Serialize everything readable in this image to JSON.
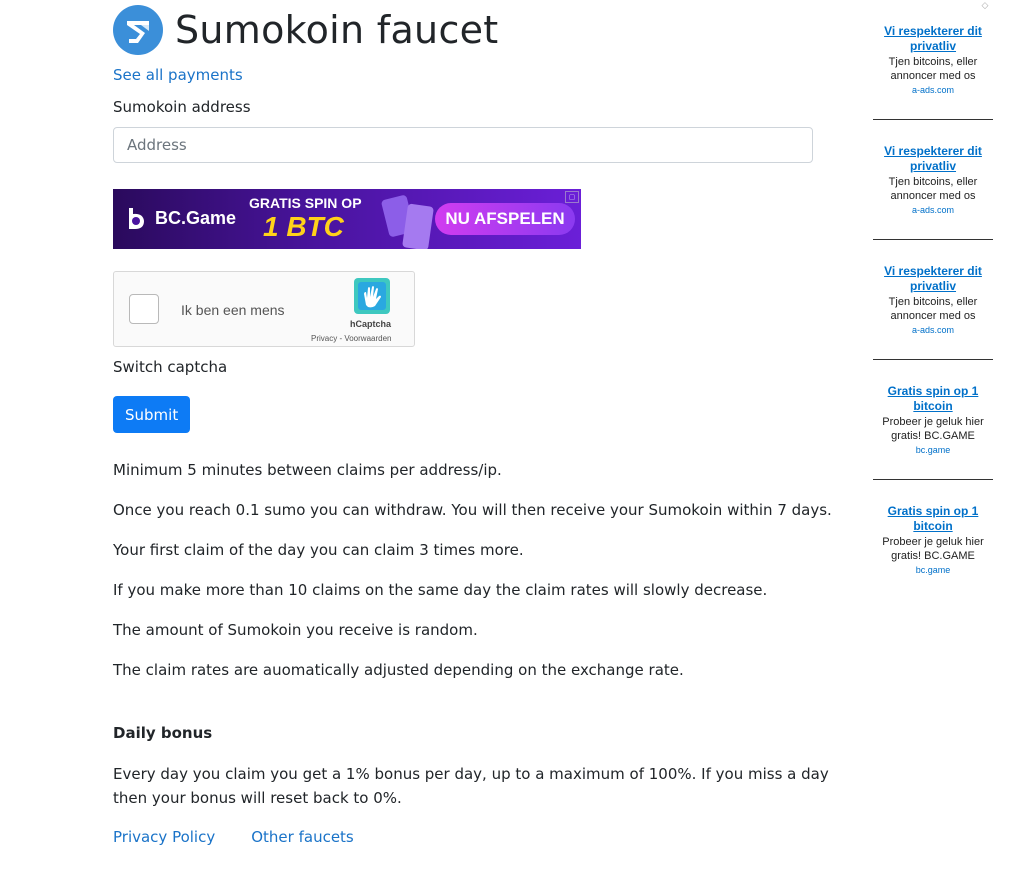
{
  "header": {
    "title": "Sumokoin faucet",
    "logo_icon": "sumokoin-logo-icon",
    "brand_color": "#3b8fd9"
  },
  "nav": {
    "see_all_payments": "See all payments"
  },
  "form": {
    "address_label": "Sumokoin address",
    "address_placeholder": "Address",
    "address_value": "",
    "switch_captcha": "Switch captcha",
    "submit_label": "Submit",
    "submit_color": "#0d7bf5"
  },
  "banner": {
    "brand": "BC.Game",
    "promo_line": "GRATIS SPIN OP",
    "promo_big": "1 BTC",
    "cta": "NU AFSPELEN"
  },
  "captcha": {
    "checkbox_label": "Ik ben een mens",
    "brand": "hCaptcha",
    "terms": "Privacy - Voorwaarden"
  },
  "info": [
    "Minimum 5 minutes between claims per address/ip.",
    "Once you reach 0.1 sumo you can withdraw. You will then receive your Sumokoin within 7 days.",
    "Your first claim of the day you can claim 3 times more.",
    "If you make more than 10 claims on the same day the claim rates will slowly decrease.",
    "The amount of Sumokoin you receive is random.",
    "The claim rates are auomatically adjusted depending on the exchange rate."
  ],
  "bonus": {
    "heading": "Daily bonus",
    "text": "Every day you claim you get a 1% bonus per day, up to a maximum of 100%. If you miss a day then your bonus will reset back to 0%."
  },
  "footer": {
    "privacy": "Privacy Policy",
    "other": "Other faucets"
  },
  "sidebar_ads": [
    {
      "title": "Vi respekterer dit privatliv",
      "body": "Tjen bitcoins, eller annoncer med os",
      "domain": "a-ads.com"
    },
    {
      "title": "Vi respekterer dit privatliv",
      "body": "Tjen bitcoins, eller annoncer med os",
      "domain": "a-ads.com"
    },
    {
      "title": "Vi respekterer dit privatliv",
      "body": "Tjen bitcoins, eller annoncer med os",
      "domain": "a-ads.com"
    },
    {
      "title": "Gratis spin op 1 bitcoin",
      "body": "Probeer je geluk hier gratis! BC.GAME",
      "domain": "bc.game"
    },
    {
      "title": "Gratis spin op 1 bitcoin",
      "body": "Probeer je geluk hier gratis! BC.GAME",
      "domain": "bc.game"
    }
  ],
  "link_color": "#1a73c8"
}
